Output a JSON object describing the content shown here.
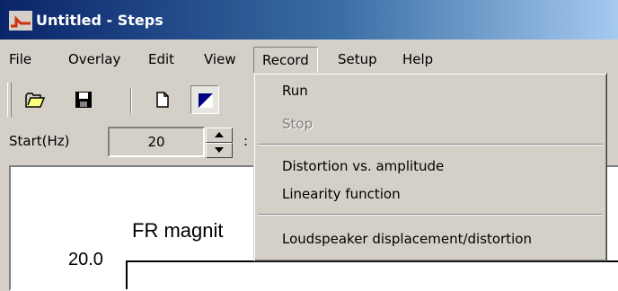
{
  "window": {
    "title": "Untitled - Steps",
    "icon": "steps-app-icon"
  },
  "menubar": {
    "items": [
      {
        "label": "File"
      },
      {
        "label": "Overlay"
      },
      {
        "label": "Edit"
      },
      {
        "label": "View"
      },
      {
        "label": "Record",
        "open": true
      },
      {
        "label": "Setup"
      },
      {
        "label": "Help"
      }
    ]
  },
  "toolbar": {
    "buttons": [
      {
        "icon": "open-folder-icon"
      },
      {
        "icon": "save-disk-icon"
      },
      {
        "icon": "new-document-icon"
      },
      {
        "icon": "triangle-mode-icon",
        "pressed": true
      }
    ]
  },
  "params": {
    "start_label": "Start(Hz)",
    "start_value": "20",
    "trailing_text": ":"
  },
  "plot": {
    "title_partial": "FR magnit",
    "y_tick_top": "20.0"
  },
  "record_menu": {
    "items": [
      {
        "label": "Run",
        "enabled": true
      },
      {
        "label": "Stop",
        "enabled": false
      },
      {
        "label": "Distortion vs. amplitude",
        "enabled": true
      },
      {
        "label": "Linearity function",
        "enabled": true
      },
      {
        "label": "Loudspeaker displacement/distortion",
        "enabled": true
      }
    ]
  },
  "colors": {
    "title_start": "#0a246a",
    "title_end": "#a6caf0",
    "face": "#d4d0c8",
    "app_icon": "#d03010"
  }
}
